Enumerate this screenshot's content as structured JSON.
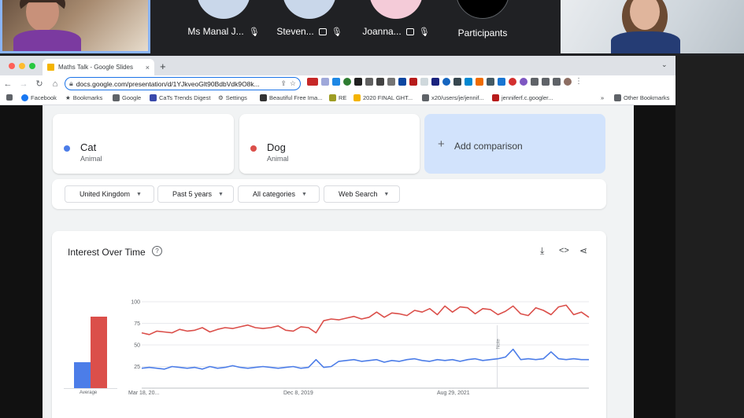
{
  "meeting": {
    "participants": [
      {
        "name": "Ms Manal J...",
        "avatar_color": "#c9d7ea",
        "mic_off": true,
        "status": false
      },
      {
        "name": "Steven...",
        "avatar_color": "#c9d7ea",
        "mic_off": true,
        "status": true
      },
      {
        "name": "Joanna...",
        "avatar_color": "#f4cbd8",
        "mic_off": true,
        "status": true
      },
      {
        "name": "Participants",
        "avatar_color": "#000000",
        "mic_off": false,
        "status": false
      }
    ]
  },
  "browser": {
    "tab_title": "Maths Talk - Google Slides",
    "tab_close": "×",
    "new_tab": "+",
    "tab_menu": "⌄",
    "url": "docs.google.com/presentation/d/1YJkveoGlt90BdbVdk9O8k...",
    "bookmarks": [
      {
        "label": "Facebook",
        "color": "#1877f2"
      },
      {
        "label": "Bookmarks",
        "color": "#5f6368"
      },
      {
        "label": "Google",
        "color": "#5f6368"
      },
      {
        "label": "CaTs Trends Digest",
        "color": "#3949ab"
      },
      {
        "label": "Settings",
        "color": "#5f6368"
      },
      {
        "label": "Beautiful Free Ima...",
        "color": "#333333"
      },
      {
        "label": "RE",
        "color": "#9e9d24"
      },
      {
        "label": "2020 FINAL GHT...",
        "color": "#f4b400"
      },
      {
        "label": "x20/users/je/jennif...",
        "color": "#5f6368"
      },
      {
        "label": "jenniferf.c.googler...",
        "color": "#b71c1c"
      }
    ],
    "more": "»",
    "other_bookmarks": "Other Bookmarks"
  },
  "trends": {
    "terms": [
      {
        "term": "Cat",
        "type": "Animal",
        "color": "#4c7de8"
      },
      {
        "term": "Dog",
        "type": "Animal",
        "color": "#db4f4a"
      }
    ],
    "add_comparison": "Add comparison",
    "filters": [
      "United Kingdom",
      "Past 5 years",
      "All categories",
      "Web Search"
    ],
    "card_title": "Interest Over Time",
    "average_label": "Average",
    "note_label": "Note"
  },
  "chart_data": {
    "type": "line",
    "title": "Interest Over Time",
    "ylim": [
      0,
      100
    ],
    "yticks": [
      25,
      50,
      75,
      100
    ],
    "x_tick_labels": [
      "Mar 18, 20...",
      "Dec 8, 2019",
      "Aug 29, 2021"
    ],
    "grid": true,
    "x_points": 60,
    "series": [
      {
        "name": "Cat",
        "color": "#4c7de8",
        "average": 29,
        "values": [
          23,
          24,
          23,
          22,
          25,
          24,
          23,
          24,
          22,
          25,
          23,
          24,
          26,
          24,
          23,
          24,
          25,
          24,
          23,
          24,
          25,
          23,
          24,
          33,
          24,
          25,
          31,
          32,
          33,
          31,
          32,
          33,
          30,
          32,
          31,
          33,
          34,
          32,
          31,
          33,
          32,
          33,
          31,
          33,
          34,
          32,
          33,
          34,
          36,
          45,
          33,
          34,
          33,
          34,
          42,
          34,
          33,
          34,
          33,
          33
        ]
      },
      {
        "name": "Dog",
        "color": "#db4f4a",
        "average": 79,
        "values": [
          64,
          62,
          66,
          65,
          64,
          68,
          66,
          67,
          70,
          65,
          68,
          70,
          69,
          71,
          73,
          70,
          69,
          70,
          72,
          67,
          66,
          71,
          70,
          64,
          78,
          80,
          79,
          81,
          83,
          80,
          82,
          88,
          82,
          87,
          86,
          84,
          90,
          88,
          92,
          85,
          95,
          88,
          94,
          93,
          86,
          92,
          91,
          85,
          89,
          95,
          86,
          84,
          93,
          90,
          85,
          94,
          96,
          85,
          88,
          82
        ]
      }
    ]
  }
}
